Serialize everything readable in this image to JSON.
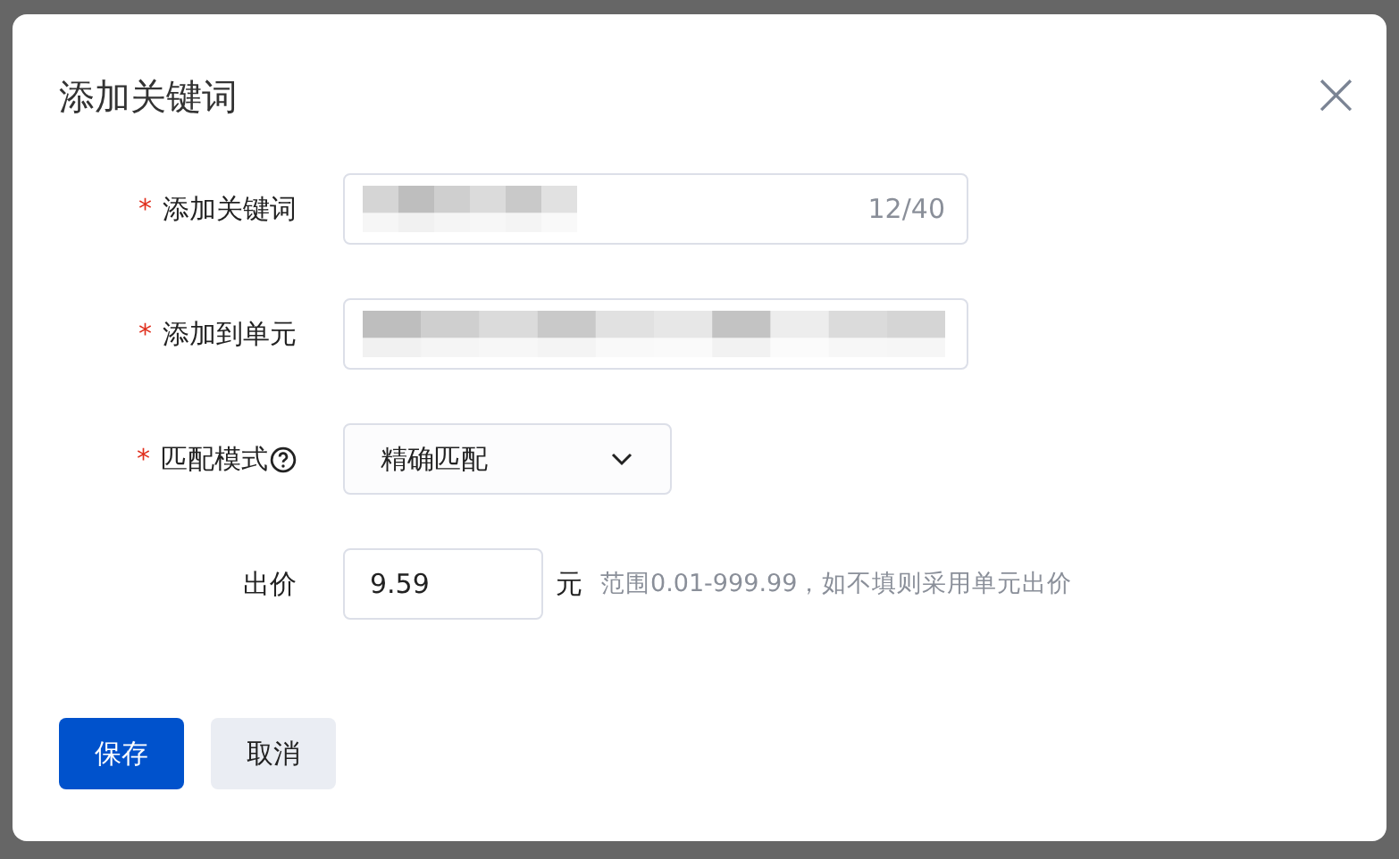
{
  "dialog": {
    "title": "添加关键词",
    "close_icon": "×"
  },
  "fields": [
    {
      "kind": "text",
      "label": "添加关键词",
      "required_mark": "*",
      "redacted": true,
      "counter": "12/40"
    },
    {
      "kind": "text",
      "label": "添加到单元",
      "required_mark": "*",
      "redacted": true
    },
    {
      "kind": "select",
      "label": "匹配模式",
      "required_mark": "*",
      "help": true,
      "value": "精确匹配"
    },
    {
      "kind": "number",
      "label": "出价",
      "value": "9.59",
      "unit": "元",
      "hint": "范围0.01-999.99，如不填则采用单元出价"
    }
  ],
  "buttons": [
    {
      "label": "保存",
      "primary": true
    },
    {
      "label": "取消",
      "primary": false
    }
  ]
}
